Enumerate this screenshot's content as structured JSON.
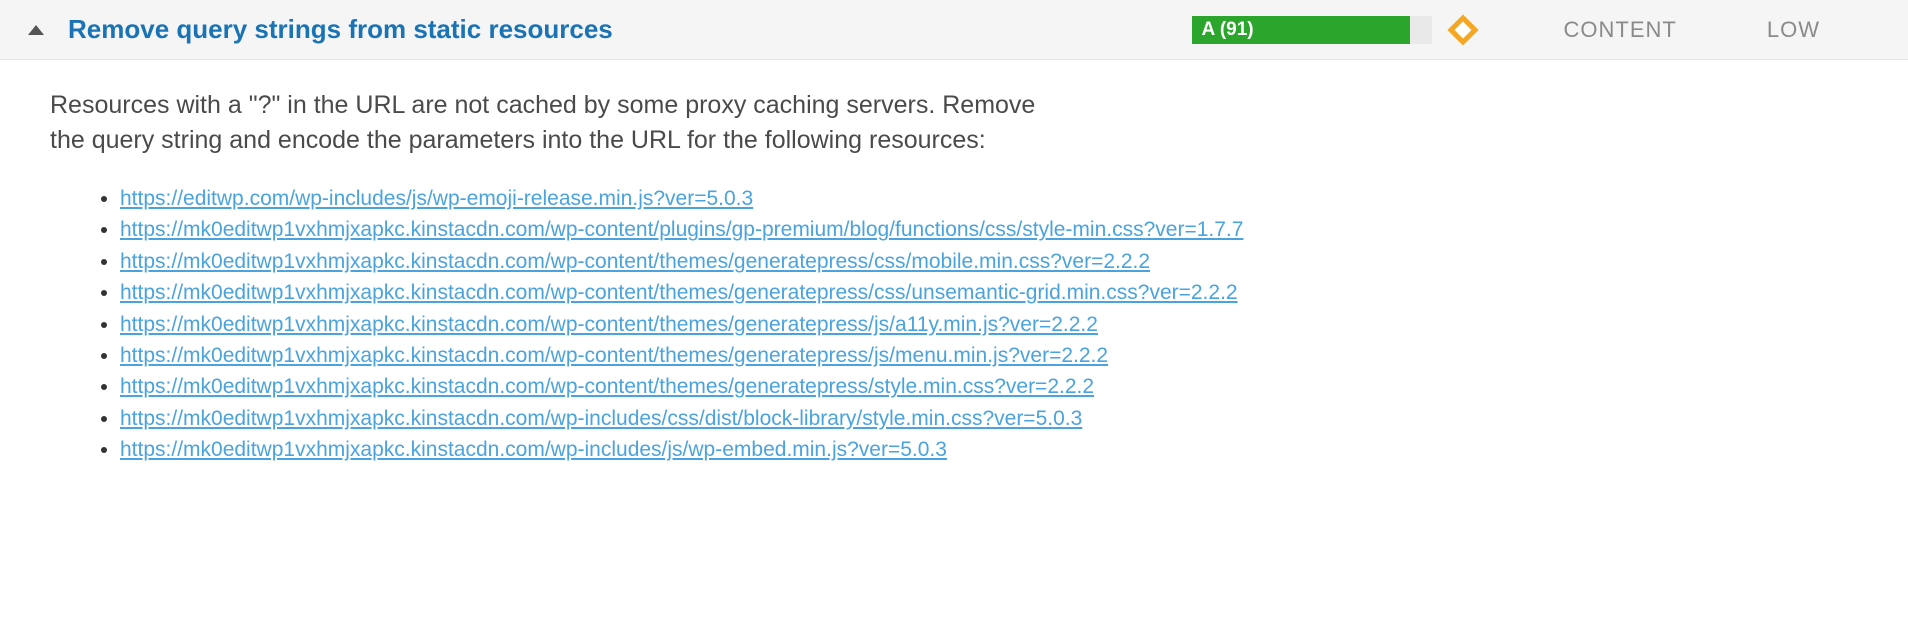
{
  "header": {
    "title": "Remove query strings from static resources",
    "grade_text": "A (91)",
    "grade_percent": "91%",
    "type": "CONTENT",
    "priority": "LOW"
  },
  "body": {
    "description": "Resources with a \"?\" in the URL are not cached by some proxy caching servers. Remove the query string and encode the parameters into the URL for the following resources:",
    "resources": [
      "https://editwp.com/wp-includes/js/wp-emoji-release.min.js?ver=5.0.3",
      "https://mk0editwp1vxhmjxapkc.kinstacdn.com/wp-content/plugins/gp-premium/blog/functions/css/style-min.css?ver=1.7.7",
      "https://mk0editwp1vxhmjxapkc.kinstacdn.com/wp-content/themes/generatepress/css/mobile.min.css?ver=2.2.2",
      "https://mk0editwp1vxhmjxapkc.kinstacdn.com/wp-content/themes/generatepress/css/unsemantic-grid.min.css?ver=2.2.2",
      "https://mk0editwp1vxhmjxapkc.kinstacdn.com/wp-content/themes/generatepress/js/a11y.min.js?ver=2.2.2",
      "https://mk0editwp1vxhmjxapkc.kinstacdn.com/wp-content/themes/generatepress/js/menu.min.js?ver=2.2.2",
      "https://mk0editwp1vxhmjxapkc.kinstacdn.com/wp-content/themes/generatepress/style.min.css?ver=2.2.2",
      "https://mk0editwp1vxhmjxapkc.kinstacdn.com/wp-includes/css/dist/block-library/style.min.css?ver=5.0.3",
      "https://mk0editwp1vxhmjxapkc.kinstacdn.com/wp-includes/js/wp-embed.min.js?ver=5.0.3"
    ]
  }
}
